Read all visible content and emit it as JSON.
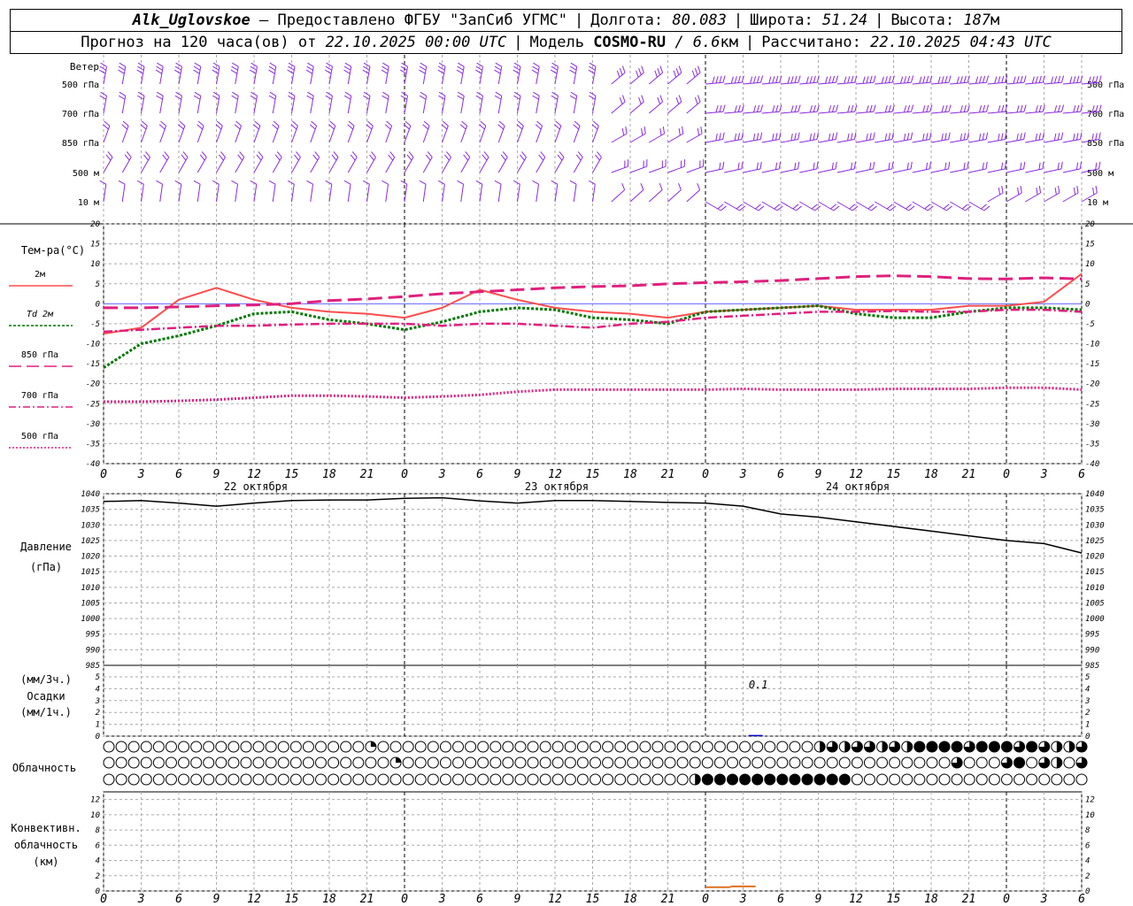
{
  "header": {
    "station": "Alk_Uglovskoe",
    "provider": "– Предоставлено ФГБУ \"ЗапСиб УГМС\"",
    "lon_label": "Долгота:",
    "lon": "80.083",
    "lat_label": "Широта:",
    "lat": "51.24",
    "alt_label": "Высота:",
    "alt": "187",
    "alt_unit": "м",
    "forecast_label": "Прогноз на 120 часа(ов) от",
    "forecast_time": "22.10.2025 00:00 UTC",
    "model_label": "Модель",
    "model": "COSMO-RU",
    "resolution": "/ 6.6",
    "res_unit": "км",
    "calc_label": "Рассчитано:",
    "calc_time": "22.10.2025 04:43 UTC",
    "sep": "|"
  },
  "labels": {
    "wind": "Ветер",
    "wind_levels": [
      "500 гПа",
      "700 гПа",
      "850 гПа",
      "500 м",
      "10 м"
    ],
    "temp": "Тем-ра(°С)",
    "legend": [
      {
        "label": "2м",
        "color": "#ff4d4d",
        "dash": ""
      },
      {
        "label": "Td 2м",
        "color": "#007700",
        "dash": "3,2"
      },
      {
        "label": "850 гПа",
        "color": "#e0207d",
        "dash": "14,6"
      },
      {
        "label": "700 гПа",
        "color": "#e0207d",
        "dash": "8,3,2,3"
      },
      {
        "label": "500 гПа",
        "color": "#e0207d",
        "dash": "2,2"
      }
    ],
    "pressure": [
      "Давление",
      "(гПа)"
    ],
    "precip": [
      "(мм/3ч.)",
      "Осадки",
      "(мм/1ч.)"
    ],
    "precip_note": "0.1",
    "cloud": "Облачность",
    "conv": [
      "Конвективн.",
      "облачность",
      "(км)"
    ]
  },
  "colors": {
    "wind": "#8a2be2",
    "grid": "#aaaaaa",
    "pressure": "#000000",
    "conv": "#e07020",
    "precip": "#0000cc"
  },
  "chart_data": [
    {
      "type": "line",
      "title": "Тем-ра(°С)",
      "xlabel": "",
      "ylabel": "Тем-ра(°С)",
      "ylim": [
        -40,
        20
      ],
      "x_hours": [
        0,
        3,
        6,
        9,
        12,
        15,
        18,
        21,
        24,
        27,
        30,
        33,
        36,
        39,
        42,
        45,
        48,
        51,
        54,
        57,
        60,
        63,
        66,
        69,
        72,
        75,
        78
      ],
      "x_tick_labels": [
        "0",
        "3",
        "6",
        "9",
        "12",
        "15",
        "18",
        "21",
        "0",
        "3",
        "6",
        "9",
        "12",
        "15",
        "18",
        "21",
        "0",
        "3",
        "6",
        "9",
        "12",
        "15",
        "18",
        "21",
        "0",
        "3",
        "6"
      ],
      "day_labels": [
        "22 октября",
        "23 октября",
        "24 октября"
      ],
      "series": [
        {
          "name": "2м",
          "values": [
            -7.5,
            -6,
            1,
            4,
            1,
            -1,
            -2,
            -2.5,
            -3.5,
            -1,
            3.5,
            1,
            -1,
            -2,
            -2.5,
            -3.5,
            -2,
            -1.5,
            -1,
            -0.5,
            -1.5,
            -1.5,
            -1.5,
            -0.5,
            -0.5,
            0.5,
            7.5
          ]
        },
        {
          "name": "Td 2м",
          "values": [
            -16,
            -10,
            -8,
            -5.5,
            -2.5,
            -2,
            -4,
            -5,
            -6.5,
            -4.5,
            -2,
            -1,
            -1.5,
            -3.5,
            -4,
            -5,
            -2,
            -1.5,
            -1,
            -0.5,
            -2.5,
            -3.5,
            -3.5,
            -2,
            -1,
            -1,
            -1.5
          ]
        },
        {
          "name": "850 гПа",
          "values": [
            -1,
            -1,
            -0.8,
            -0.5,
            -0.3,
            0,
            0.8,
            1.2,
            1.8,
            2.5,
            3,
            3.5,
            4,
            4.3,
            4.5,
            5,
            5.3,
            5.5,
            5.8,
            6.3,
            6.8,
            7,
            6.8,
            6.3,
            6.2,
            6.5,
            6.2
          ]
        },
        {
          "name": "700 гПа",
          "values": [
            -7,
            -6.5,
            -6,
            -5.5,
            -5.5,
            -5.2,
            -5,
            -5,
            -5,
            -5.5,
            -5,
            -5,
            -5.5,
            -6,
            -5,
            -4.5,
            -3.5,
            -3,
            -2.5,
            -2,
            -2,
            -1.8,
            -2,
            -2,
            -1.5,
            -1.5,
            -2
          ]
        },
        {
          "name": "500 гПа",
          "values": [
            -24.5,
            -24.5,
            -24.3,
            -24,
            -23.5,
            -23,
            -23,
            -23.2,
            -23.5,
            -23.2,
            -22.8,
            -22,
            -21.5,
            -21.5,
            -21.5,
            -21.5,
            -21.5,
            -21.3,
            -21.5,
            -21.5,
            -21.5,
            -21.3,
            -21.3,
            -21.3,
            -21,
            -21,
            -21.5
          ]
        }
      ]
    },
    {
      "type": "line",
      "title": "Давление",
      "ylabel": "(гПа)",
      "ylim": [
        985,
        1040
      ],
      "y_ticks": [
        985,
        990,
        995,
        1000,
        1005,
        1010,
        1015,
        1020,
        1025,
        1030,
        1035,
        1040
      ],
      "x_hours": [
        0,
        3,
        6,
        9,
        12,
        15,
        18,
        21,
        24,
        27,
        30,
        33,
        36,
        39,
        42,
        45,
        48,
        51,
        54,
        57,
        60,
        63,
        66,
        69,
        72,
        75,
        78
      ],
      "series": [
        {
          "name": "Давление",
          "values": [
            1037.5,
            1037.8,
            1037,
            1036,
            1037,
            1037.8,
            1038,
            1038,
            1038.5,
            1038.7,
            1037.7,
            1037,
            1037.8,
            1037.8,
            1037.5,
            1037.2,
            1037,
            1036,
            1033.5,
            1032.5,
            1031,
            1029.5,
            1028,
            1026.5,
            1025,
            1024,
            1021
          ]
        }
      ]
    },
    {
      "type": "bar",
      "title": "Осадки",
      "ylim": [
        0,
        5
      ],
      "y_ticks": [
        0,
        1,
        2,
        3,
        4,
        5
      ],
      "values_note": "0.1",
      "events": [
        {
          "hour": 52,
          "value": 0.1
        }
      ]
    },
    {
      "type": "table",
      "title": "Облачность",
      "rows_top_to_bottom": [
        "верхняя",
        "средняя",
        "нижняя"
      ],
      "step_hours": 1,
      "cover_fraction": {
        "top": {
          "default": 0,
          "segments": [
            [
              21,
              0.25
            ],
            [
              57,
              0.5
            ],
            [
              58,
              0.75
            ],
            [
              59,
              0.5
            ],
            [
              60,
              0.75
            ],
            [
              61,
              0.75
            ],
            [
              62,
              0.5
            ],
            [
              63,
              0.75
            ],
            [
              64,
              0.5
            ],
            [
              65,
              1
            ],
            [
              66,
              1
            ],
            [
              67,
              1
            ],
            [
              68,
              1
            ],
            [
              69,
              0.75
            ],
            [
              70,
              1
            ],
            [
              71,
              1
            ],
            [
              72,
              1
            ],
            [
              73,
              0.75
            ],
            [
              74,
              1
            ],
            [
              75,
              0.75
            ],
            [
              76,
              0.5
            ],
            [
              77,
              0.5
            ],
            [
              78,
              0.75
            ],
            [
              79,
              0.5
            ]
          ]
        },
        "middle": {
          "default": 0,
          "segments": [
            [
              23,
              0.25
            ],
            [
              68,
              0.75
            ],
            [
              72,
              0.75
            ],
            [
              73,
              1
            ],
            [
              75,
              0.75
            ],
            [
              76,
              0.5
            ],
            [
              78,
              0.75
            ],
            [
              79,
              1
            ]
          ]
        },
        "low": {
          "default": 0,
          "segments": [
            [
              47,
              0.5
            ],
            [
              48,
              1
            ],
            [
              49,
              1
            ],
            [
              50,
              1
            ],
            [
              51,
              1
            ],
            [
              52,
              1
            ],
            [
              53,
              1
            ],
            [
              54,
              1
            ],
            [
              55,
              1
            ],
            [
              56,
              1
            ],
            [
              57,
              1
            ],
            [
              58,
              1
            ],
            [
              59,
              1
            ]
          ]
        }
      }
    },
    {
      "type": "bar",
      "title": "Конвективн. облачность",
      "ylabel": "(км)",
      "ylim": [
        0,
        13
      ],
      "y_ticks": [
        0,
        2,
        4,
        6,
        8,
        10,
        12
      ],
      "events": [
        {
          "hour_from": 48,
          "hour_to": 50,
          "value": 0.5
        },
        {
          "hour_from": 52,
          "hour_to": 54,
          "value": 0.6
        }
      ]
    },
    {
      "type": "scatter",
      "title": "Ветер",
      "levels": [
        "500 гПа",
        "700 гПа",
        "850 гПа",
        "500 м",
        "10 м"
      ],
      "note": "wind barbs, hourly"
    }
  ]
}
